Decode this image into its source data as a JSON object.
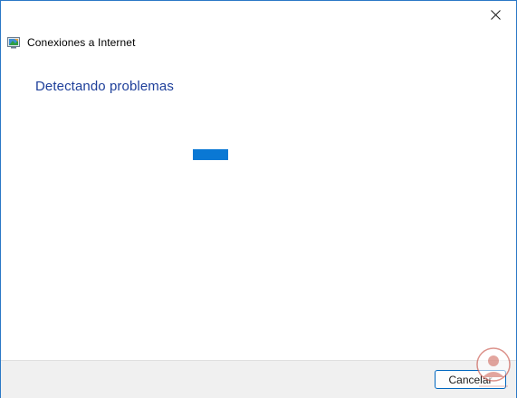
{
  "window": {
    "close_icon": "close-icon"
  },
  "header": {
    "title": "Conexiones a Internet",
    "icon": "network-troubleshooter-icon"
  },
  "main": {
    "heading": "Detectando problemas",
    "progress": {
      "state": "indeterminate",
      "color": "#0a78d4"
    }
  },
  "footer": {
    "cancel_label": "Cancelar"
  },
  "colors": {
    "accent": "#0067c0",
    "heading": "#1e3f9a",
    "footer_bg": "#f0f0f0",
    "window_border": "#2b78c6"
  }
}
